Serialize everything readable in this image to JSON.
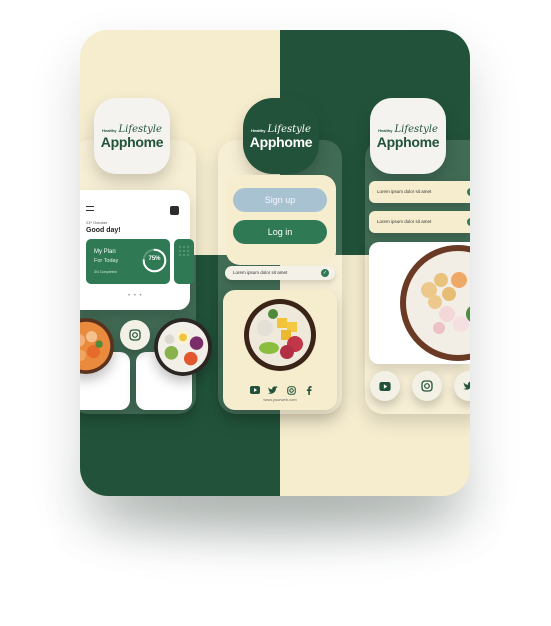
{
  "logo": {
    "small_text": "Healthy",
    "script_text": "Lifestyle",
    "main_text": "Apphome"
  },
  "plan_card": {
    "date": "23* October",
    "greeting": "Good day!",
    "plan_title": "My Plan",
    "plan_subtitle": "For Today",
    "plan_progress_label": "75%",
    "plan_progress": 0.75,
    "completed_text": "3/4 Completed",
    "pager": "• • •"
  },
  "auth": {
    "signup_label": "Sign up",
    "login_label": "Log in"
  },
  "lorem": {
    "item_1": "Lorem ipsum dolor sit amet",
    "item_2": "Lorem ipsum dolor sit amet",
    "item_3": "Lorem ipsum dolor sit amet"
  },
  "footer": {
    "website": "www.yourweb.com"
  },
  "icons": {
    "youtube": "youtube-icon",
    "twitter": "twitter-icon",
    "instagram": "instagram-icon",
    "facebook": "facebook-icon",
    "check": "check-icon",
    "menu": "menu-icon",
    "profile": "profile-icon"
  },
  "colors": {
    "brand_green": "#22533a",
    "accent_green": "#2f7a55",
    "cream": "#f6edcf",
    "signup_blue": "#a9c2d2"
  }
}
